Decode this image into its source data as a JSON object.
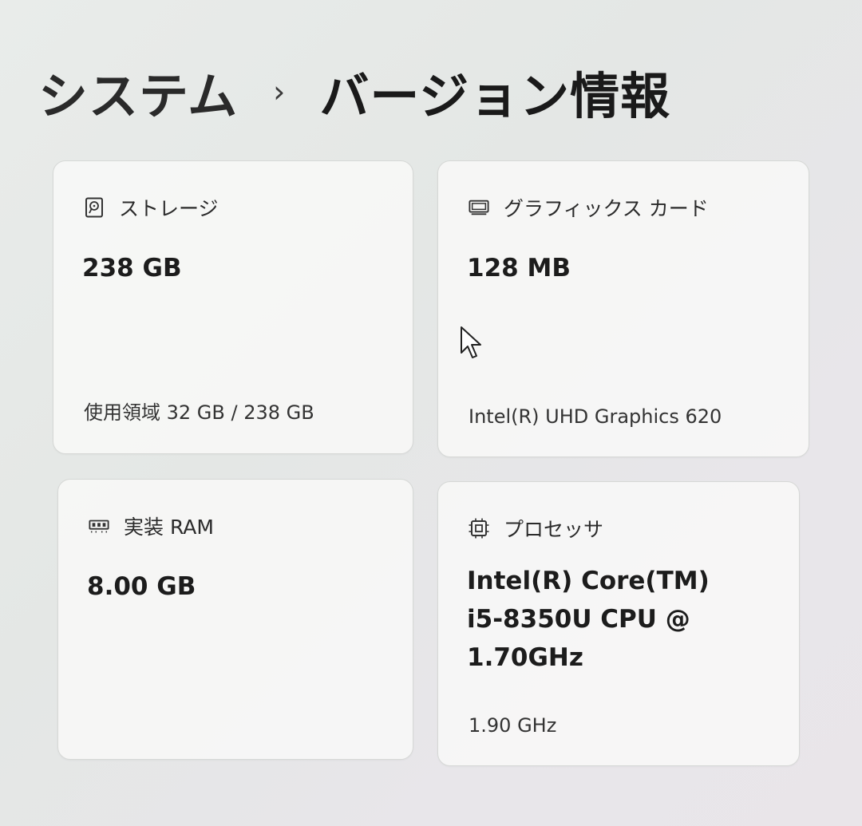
{
  "breadcrumb": {
    "parent": "システム",
    "separator": "›",
    "current": "バージョン情報"
  },
  "cards": {
    "storage": {
      "icon": "hard-drive-icon",
      "title": "ストレージ",
      "value": "238 GB",
      "sub": "使用領域 32 GB / 238 GB"
    },
    "gpu": {
      "icon": "display-card-icon",
      "title": "グラフィックス カード",
      "value": "128 MB",
      "sub": "Intel(R) UHD Graphics 620"
    },
    "ram": {
      "icon": "memory-module-icon",
      "title": "実装 RAM",
      "value": "8.00 GB"
    },
    "cpu": {
      "icon": "processor-chip-icon",
      "title": "プロセッサ",
      "value": "Intel(R) Core(TM)\ni5-8350U CPU @\n1.70GHz",
      "sub": "1.90 GHz"
    }
  }
}
